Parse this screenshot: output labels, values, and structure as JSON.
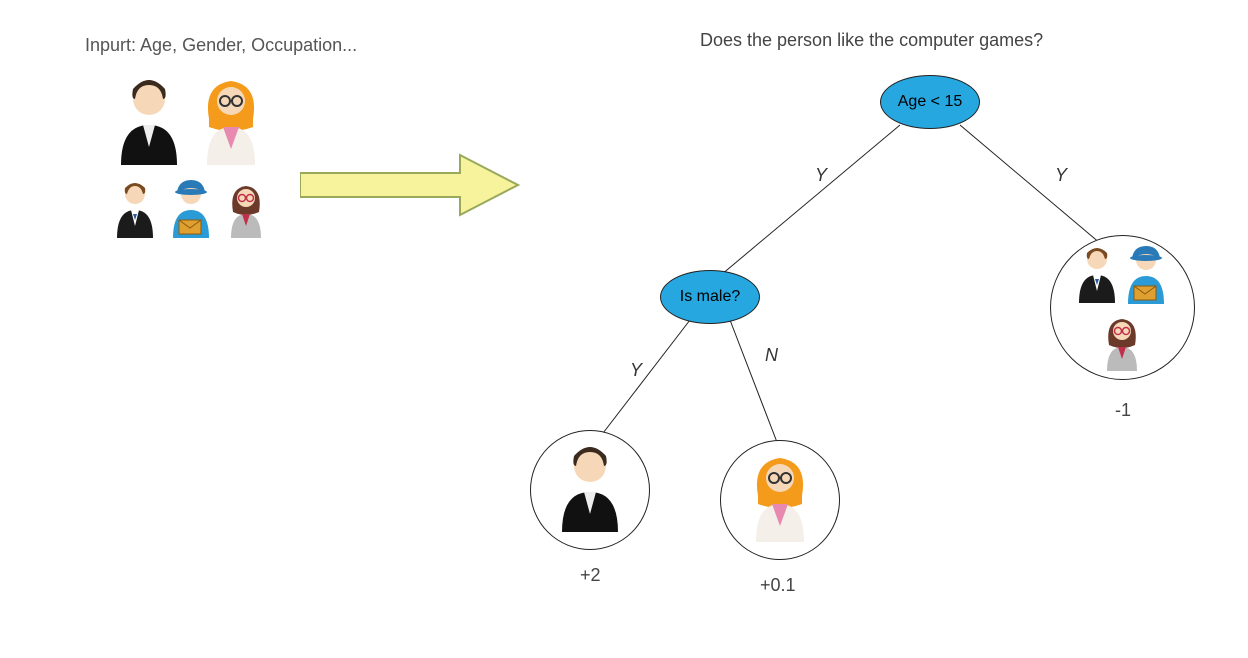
{
  "input_label": "Inpurt: Age, Gender, Occupation...",
  "question": "Does the person like the computer games?",
  "tree": {
    "root": {
      "label": "Age < 15",
      "left_edge": "Y",
      "right_edge": "Y"
    },
    "node_is_male": {
      "label": "Is male?",
      "left_edge": "Y",
      "right_edge": "N"
    },
    "leaf_left_score": "+2",
    "leaf_mid_score": "+0.1",
    "leaf_right_score": "-1"
  },
  "colors": {
    "node_fill": "#26a7e0",
    "arrow_fill": "#f6f39c",
    "arrow_stroke": "#9aa85a"
  },
  "icons": {
    "male_dark": "male-dark-jacket-icon",
    "female_orange": "female-orange-glasses-icon",
    "male_suit": "male-suit-icon",
    "male_blue_hat": "male-blue-hat-envelope-icon",
    "female_brown": "female-brown-glasses-icon"
  }
}
